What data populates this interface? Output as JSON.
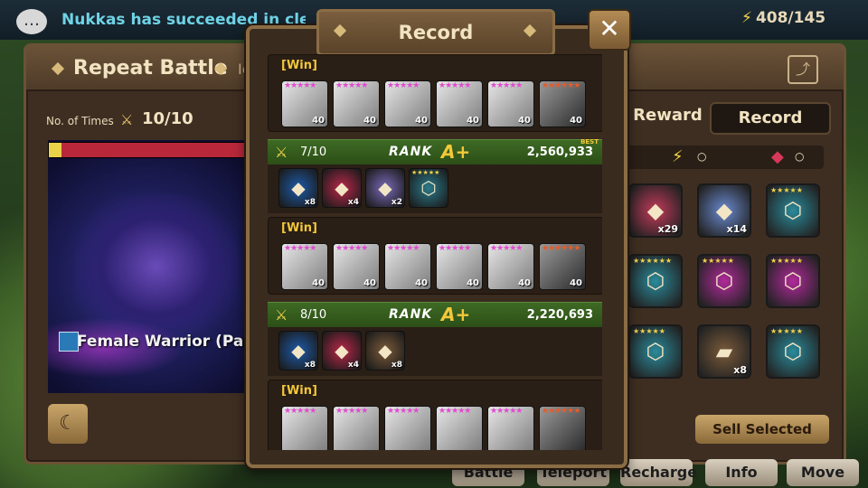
{
  "topbar": {
    "chat_icon": "chat-bubble-icon",
    "ticker": "Nukkas has succeeded in clearing",
    "energy": "408/145"
  },
  "repeat_battle": {
    "title": "Repeat Battle",
    "title_suffix": "Ic",
    "times_label": "No. of Times",
    "times_value": "10/10",
    "unit_name": "Female Warrior (Pa",
    "moon_icon": "moon-icon"
  },
  "reward_panel": {
    "reward_label": "d Reward",
    "record_button": "Record",
    "stat_dot_1": "○",
    "stat_dot_2": "○",
    "rewards": [
      {
        "kind": "rune-crystal-pink",
        "qty": "x29",
        "color": "#c23a5a"
      },
      {
        "kind": "rune-crystal-multi",
        "qty": "x14",
        "color": "#6a8ad0"
      },
      {
        "kind": "rune-teal",
        "stars": "★★★★★",
        "color": "#2a8a9a"
      },
      {
        "kind": "rune-teal",
        "stars": "★★★★★★",
        "color": "#2a8a9a"
      },
      {
        "kind": "rune-magenta",
        "stars": "★★★★★",
        "color": "#b02a9a"
      },
      {
        "kind": "rune-magenta",
        "stars": "★★★★★",
        "color": "#b02a9a"
      },
      {
        "kind": "rune-teal",
        "stars": "★★★★★",
        "color": "#2a8a9a"
      },
      {
        "kind": "rune-stone",
        "qty": "x8",
        "color": "#7a5a3a"
      },
      {
        "kind": "rune-teal",
        "stars": "★★★★★",
        "color": "#2a8a9a"
      }
    ],
    "sell_button": "Sell Selected"
  },
  "bottom_buttons": [
    "Battle",
    "Teleport",
    "Recharge",
    "Info",
    "Move"
  ],
  "record": {
    "title": "Record",
    "close_label": "✕",
    "entries": [
      {
        "type": "win",
        "label": "[Win]",
        "monsters": [
          "40",
          "40",
          "40",
          "40",
          "40",
          "40"
        ]
      },
      {
        "type": "rank",
        "count": "7/10",
        "rank_label": "RANK",
        "grade": "A+",
        "score": "2,560,933",
        "best": "BEST",
        "drops": [
          {
            "qty": "x8",
            "color": "#1e5aa8"
          },
          {
            "qty": "x4",
            "color": "#b8284a"
          },
          {
            "qty": "x2",
            "color": "#7a6ab8"
          },
          {
            "stars": "★★★★★",
            "color": "#2a7a8a"
          }
        ]
      },
      {
        "type": "win",
        "label": "[Win]",
        "monsters": [
          "40",
          "40",
          "40",
          "40",
          "40",
          "40"
        ]
      },
      {
        "type": "rank",
        "count": "8/10",
        "rank_label": "RANK",
        "grade": "A+",
        "score": "2,220,693",
        "best": "",
        "drops": [
          {
            "qty": "x8",
            "color": "#1e5aa8"
          },
          {
            "qty": "x4",
            "color": "#b8284a"
          },
          {
            "qty": "x8",
            "color": "#7a5a3a"
          }
        ]
      },
      {
        "type": "win",
        "label": "[Win]",
        "monsters": [
          "",
          "",
          "",
          "",
          "",
          ""
        ]
      }
    ]
  }
}
